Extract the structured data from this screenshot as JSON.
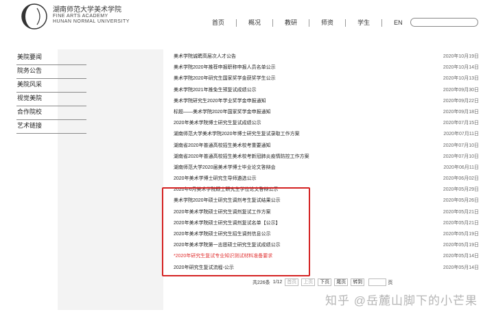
{
  "header": {
    "logo_cn": "湖南师范大学美术学院",
    "logo_en1": "FINE ARTS ACADEMY",
    "logo_en2": "HUNAN NORMAL UNIVERSITY",
    "nav": [
      "首页",
      "概况",
      "教研",
      "师资",
      "学生",
      "EN"
    ],
    "search_placeholder": ""
  },
  "sidebar": {
    "items": [
      "美院要闻",
      "院务公告",
      "美院风采",
      "视觉美院",
      "合作院校",
      "艺术链接"
    ]
  },
  "news": [
    {
      "title": "美术学院诚聘高层次人才公告",
      "date": "2020年10月19日"
    },
    {
      "title": "美术学院2020年推荐申报职称申报人员名单公示",
      "date": "2020年10月14日"
    },
    {
      "title": "美术学院2020年研究生国家奖学金获奖学生公示",
      "date": "2020年10月13日"
    },
    {
      "title": "美术学院2021年推免生预复试成绩公示",
      "date": "2020年09月30日"
    },
    {
      "title": "美术学院研究生2020年学业奖学金申报通知",
      "date": "2020年09月22日"
    },
    {
      "title": "标题——美术学院2020年国家奖学金申报通知",
      "date": "2020年09月18日"
    },
    {
      "title": "2020年美术学院博士研究生复试成绩公示",
      "date": "2020年07月15日"
    },
    {
      "title": "湖南师范大学美术学院2020年博士研究生复试录取工作方案",
      "date": "2020年07月11日"
    },
    {
      "title": "湖南省2020年普通高校招生美术校考重要通知",
      "date": "2020年07月10日"
    },
    {
      "title": "湖南省2020年普通高校招生美术校考新冠肺炎疫情防控工作方案",
      "date": "2020年07月10日"
    },
    {
      "title": "湖南师范大学2020届美术学博士毕业论文答辩会",
      "date": "2020年06月11日"
    },
    {
      "title": "2020年美术学博士研究生导师遴选公示",
      "date": "2020年06月02日"
    },
    {
      "title": "2020年6月美术学院硕士研究生学位论文答辩公示",
      "date": "2020年05月29日"
    },
    {
      "title": "美术学院2020年硕士研究生调剂考生复试结果公示",
      "date": "2020年05月26日"
    },
    {
      "title": "2020年美术学院硕士研究生调剂复试工作方案",
      "date": "2020年05月21日"
    },
    {
      "title": "2020年美术学院硕士研究生调剂复试名单【公示】",
      "date": "2020年05月21日"
    },
    {
      "title": "2020年美术学院硕士研究生招生调剂信息公示",
      "date": "2020年05月19日"
    },
    {
      "title": "2020年美术学院第一志愿硕士研究生复试成绩公示",
      "date": "2020年05月19日"
    },
    {
      "title": "*2020年研究生复试专业知识测试材料准备要求",
      "date": "2020年05月14日",
      "red": true
    },
    {
      "title": "2020年研究生复试流程-公示",
      "date": "2020年05月14日"
    }
  ],
  "pager": {
    "total": "共226条",
    "page": "1/12",
    "first": "首页",
    "prev": "上页",
    "next": "下页",
    "last": "尾页",
    "goto": "转到",
    "page_unit": "页"
  },
  "watermark": "知乎 @岳麓山脚下的小芒果"
}
